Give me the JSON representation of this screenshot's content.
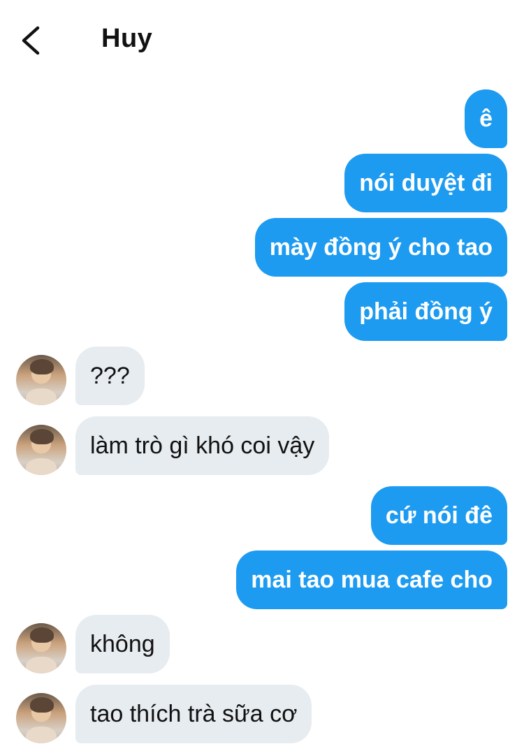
{
  "header": {
    "title": "Huy",
    "back_icon": "chevron-left-icon"
  },
  "messages": [
    {
      "side": "out",
      "text": "ê"
    },
    {
      "side": "out",
      "text": "nói duyệt đi"
    },
    {
      "side": "out",
      "text": "mày đồng ý cho tao"
    },
    {
      "side": "out",
      "text": "phải đồng ý"
    },
    {
      "side": "in",
      "text": "???"
    },
    {
      "side": "in",
      "text": "làm trò gì khó coi vậy"
    },
    {
      "side": "out",
      "text": "cứ nói đê"
    },
    {
      "side": "out",
      "text": "mai tao mua cafe cho"
    },
    {
      "side": "in",
      "text": "không"
    },
    {
      "side": "in",
      "text": "tao thích trà sữa cơ"
    }
  ],
  "colors": {
    "outgoing_bubble": "#1d9bf0",
    "incoming_bubble": "#e7ecf0"
  }
}
